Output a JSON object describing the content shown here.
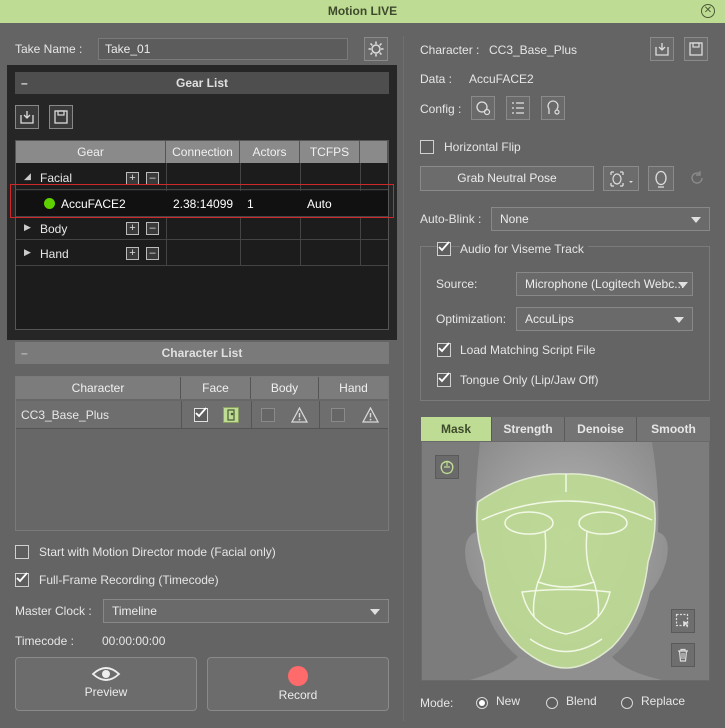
{
  "window": {
    "title": "Motion LIVE",
    "close_icon": "close-icon"
  },
  "left": {
    "take_name_label": "Take Name :",
    "take_name_value": "Take_01",
    "gear_list": {
      "title": "Gear List",
      "collapse": "–",
      "columns": [
        "Gear",
        "Connection",
        "Actors",
        "TCFPS"
      ],
      "groups": {
        "facial": "Facial",
        "body": "Body",
        "hand": "Hand"
      },
      "device": {
        "name": "AccuFACE2",
        "connection": "2.38:14099",
        "actors": "1",
        "tcfps": "Auto",
        "status_color": "#5fd000"
      }
    },
    "character_list": {
      "title": "Character List",
      "collapse": "–",
      "columns": [
        "Character",
        "Face",
        "Body",
        "Hand"
      ],
      "row": {
        "character": "CC3_Base_Plus"
      }
    },
    "start_motion_director": "Start with Motion Director mode (Facial only)",
    "full_frame_recording": "Full-Frame Recording (Timecode)",
    "master_clock_label": "Master Clock :",
    "master_clock_value": "Timeline",
    "timecode_label": "Timecode :",
    "timecode_value": "00:00:00:00",
    "preview_label": "Preview",
    "record_label": "Record"
  },
  "right": {
    "character_label": "Character :",
    "character_value": "CC3_Base_Plus",
    "data_label": "Data :",
    "data_value": "AccuFACE2",
    "config_label": "Config :",
    "horizontal_flip": "Horizontal Flip",
    "grab_neutral_pose": "Grab Neutral Pose",
    "auto_blink_label": "Auto-Blink :",
    "auto_blink_value": "None",
    "audio_viseme": "Audio for Viseme Track",
    "source_label": "Source:",
    "source_value": "Microphone (Logitech Webc...",
    "optimization_label": "Optimization:",
    "optimization_value": "AccuLips",
    "load_matching": "Load Matching Script File",
    "tongue_only": "Tongue Only (Lip/Jaw Off)",
    "tabs": [
      "Mask",
      "Strength",
      "Denoise",
      "Smooth"
    ],
    "mode_label": "Mode:",
    "mode_options": [
      "New",
      "Blend",
      "Replace"
    ],
    "accent": "#bfdc94"
  }
}
